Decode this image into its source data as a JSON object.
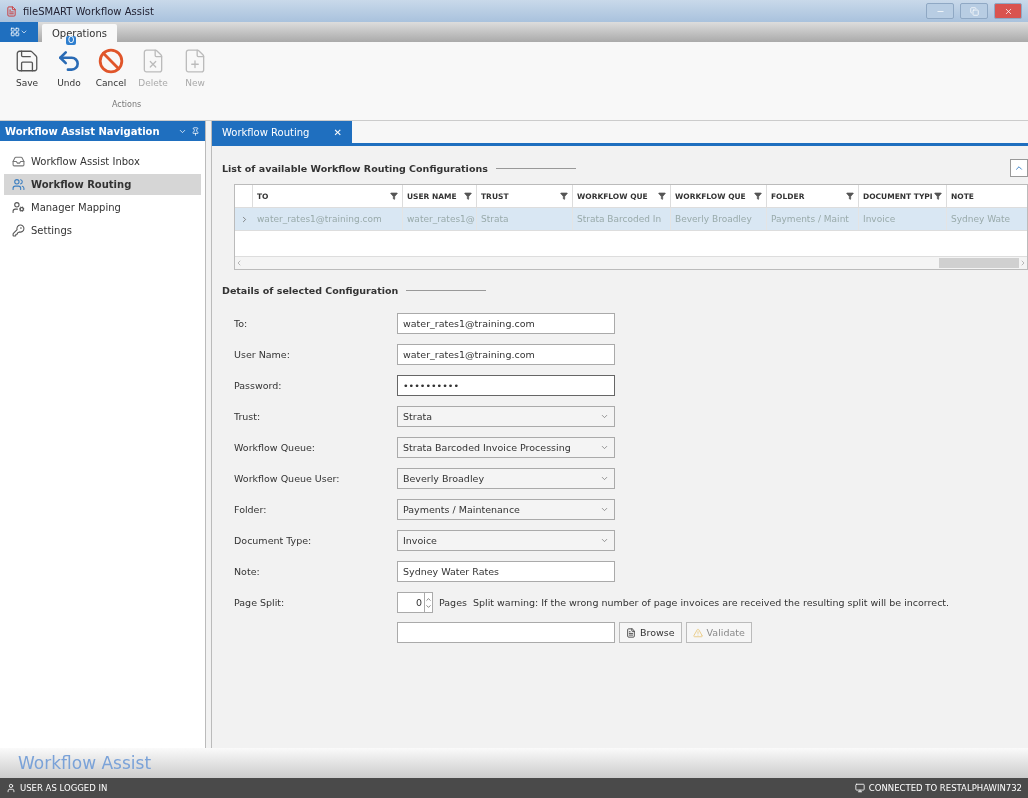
{
  "window": {
    "title": "fileSMART Workflow Assist"
  },
  "ribbon": {
    "tabs": [
      {
        "label": "Operations",
        "selected": true,
        "keytip": "O"
      }
    ],
    "buttons": [
      {
        "label": "Save",
        "disabled": false
      },
      {
        "label": "Undo",
        "disabled": false
      },
      {
        "label": "Cancel",
        "disabled": false
      },
      {
        "label": "Delete",
        "disabled": true
      },
      {
        "label": "New",
        "disabled": true
      }
    ],
    "group_label": "Actions"
  },
  "sidebar": {
    "title": "Workflow Assist Navigation",
    "items": [
      {
        "label": "Workflow Assist Inbox",
        "selected": false
      },
      {
        "label": "Workflow Routing",
        "selected": true
      },
      {
        "label": "Manager Mapping",
        "selected": false
      },
      {
        "label": "Settings",
        "selected": false
      }
    ]
  },
  "document_tab": {
    "title": "Workflow Routing",
    "close": "✕"
  },
  "list_section": {
    "title": "List of available Workflow Routing Configurations",
    "columns": [
      "TO",
      "USER NAME",
      "TRUST",
      "WORKFLOW QUE",
      "WORKFLOW QUE",
      "FOLDER",
      "DOCUMENT TYPI",
      "NOTE"
    ],
    "rows": [
      {
        "selected": true,
        "cells": [
          "water_rates1@training.com",
          "water_rates1@",
          "Strata",
          "Strata Barcoded In",
          "Beverly Broadley",
          "Payments / Maint",
          "Invoice",
          "Sydney Wate"
        ]
      }
    ]
  },
  "details_section": {
    "title": "Details of selected Configuration",
    "fields": [
      {
        "kind": "text",
        "label": "To:",
        "value": "water_rates1@training.com"
      },
      {
        "kind": "text",
        "label": "User Name:",
        "value": "water_rates1@training.com"
      },
      {
        "kind": "password",
        "label": "Password:",
        "value": "••••••••••"
      },
      {
        "kind": "dropdown",
        "label": "Trust:",
        "value": "Strata"
      },
      {
        "kind": "dropdown",
        "label": "Workflow Queue:",
        "value": "Strata Barcoded Invoice Processing"
      },
      {
        "kind": "dropdown",
        "label": "Workflow Queue User:",
        "value": "Beverly Broadley"
      },
      {
        "kind": "dropdown",
        "label": "Folder:",
        "value": "Payments / Maintenance"
      },
      {
        "kind": "dropdown",
        "label": "Document Type:",
        "value": "Invoice"
      },
      {
        "kind": "text",
        "label": "Note:",
        "value": "Sydney Water Rates"
      },
      {
        "kind": "spinner",
        "label": "Page Split:",
        "value": "0",
        "unit": "Pages",
        "hint": "Split warning: If the wrong number of page invoices are received the resulting split will be incorrect."
      }
    ],
    "file_row": {
      "browse": "Browse",
      "validate": "Validate",
      "validate_disabled": true
    }
  },
  "brand": "Workflow Assist",
  "status_bar": {
    "left": "USER AS LOGGED IN",
    "right": "CONNECTED TO RESTALPHAWIN732"
  }
}
